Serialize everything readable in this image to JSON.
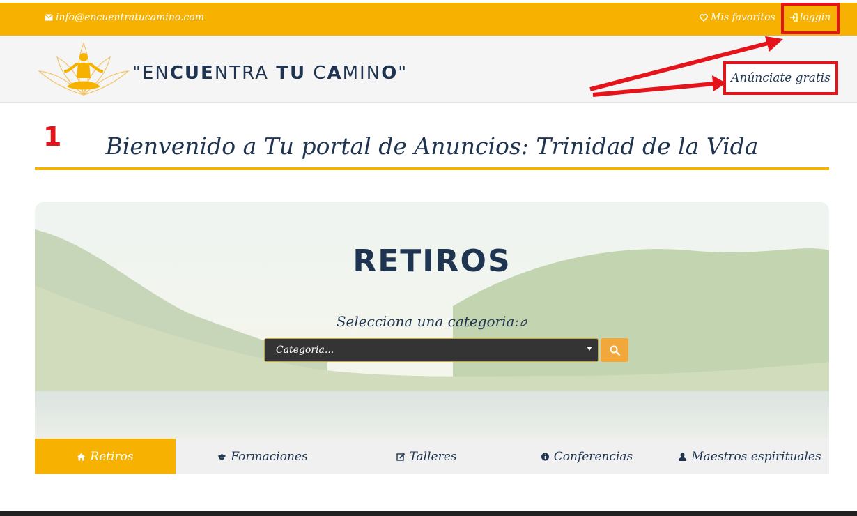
{
  "topbar": {
    "email": "info@encuentratucamino.com",
    "favorites": "Mis favoritos",
    "login": "loggin"
  },
  "header": {
    "logo_text_parts": [
      "\"EN",
      "CUE",
      "N",
      "TRA ",
      "TU",
      " C",
      "A",
      "MIN",
      "O",
      "\""
    ],
    "cta": "Anúnciate gratis"
  },
  "annotation": {
    "step_number": "1"
  },
  "welcome": {
    "title": "Bienvenido a Tu portal de Anuncios: Trinidad de la Vida"
  },
  "hero": {
    "title": "RETIROS",
    "category_label": "Selecciona una categoria:",
    "select_value": "Categoria..."
  },
  "tabs": [
    {
      "label": "Retiros",
      "icon": "home-icon",
      "active": true
    },
    {
      "label": "Formaciones",
      "icon": "graduation-cap-icon",
      "active": false
    },
    {
      "label": "Talleres",
      "icon": "edit-icon",
      "active": false
    },
    {
      "label": "Conferencias",
      "icon": "info-circle-icon",
      "active": false
    },
    {
      "label": "Maestros espirituales",
      "icon": "user-icon",
      "active": false
    }
  ],
  "colors": {
    "accent": "#f7b100",
    "navy": "#1f3450",
    "annotation_red": "#e5141a",
    "select_bg": "#343434",
    "search_button": "#f2a73a"
  }
}
